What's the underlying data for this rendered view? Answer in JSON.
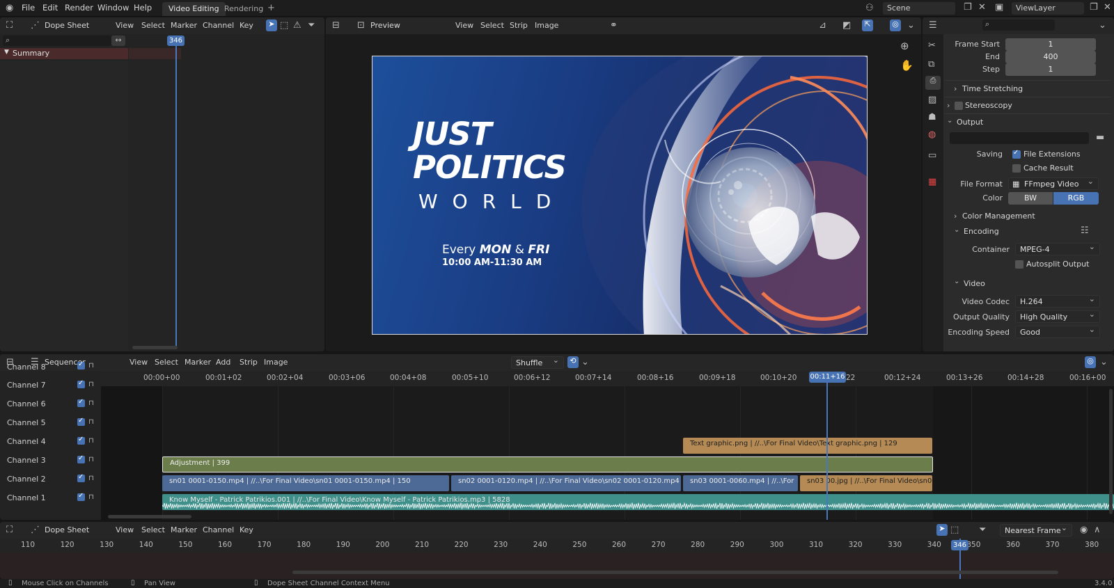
{
  "topbar": {
    "menus": [
      "File",
      "Edit",
      "Render",
      "Window",
      "Help"
    ],
    "tabs": [
      "Video Editing",
      "Rendering"
    ],
    "add_tab": "+",
    "scene": "Scene",
    "view_layer": "ViewLayer"
  },
  "dopesheet_top": {
    "editor": "Dope Sheet",
    "menus": [
      "View",
      "Select",
      "Marker",
      "Channel",
      "Key"
    ],
    "current_frame": "346",
    "summary": "Summary"
  },
  "preview": {
    "mode": "Preview",
    "menus": [
      "View",
      "Select",
      "Strip",
      "Image"
    ],
    "frame_title_line1": "JUST",
    "frame_title_line2": "POLITICS",
    "frame_title_line3": "WORLD",
    "frame_line_every": "Every",
    "frame_line_days_mon": "MON",
    "frame_line_amp": "&",
    "frame_line_days_fri": "FRI",
    "frame_line_time": "10:00 AM-11:30 AM"
  },
  "properties": {
    "frame_start_label": "Frame Start",
    "frame_start": "1",
    "end_label": "End",
    "end": "400",
    "step_label": "Step",
    "step": "1",
    "time_stretching": "Time Stretching",
    "stereoscopy": "Stereoscopy",
    "output": "Output",
    "saving_label": "Saving",
    "file_extensions": "File Extensions",
    "cache_result": "Cache Result",
    "file_format_label": "File Format",
    "file_format": "FFmpeg Video",
    "color_label": "Color",
    "color_bw": "BW",
    "color_rgb": "RGB",
    "color_management": "Color Management",
    "encoding": "Encoding",
    "container_label": "Container",
    "container": "MPEG-4",
    "autosplit": "Autosplit Output",
    "video": "Video",
    "video_codec_label": "Video Codec",
    "video_codec": "H.264",
    "output_quality_label": "Output Quality",
    "output_quality": "High Quality",
    "encoding_speed_label": "Encoding Speed",
    "encoding_speed": "Good"
  },
  "sequencer": {
    "editor": "Sequencer",
    "menus": [
      "View",
      "Select",
      "Marker",
      "Add",
      "Strip",
      "Image"
    ],
    "shuffle": "Shuffle",
    "channels": [
      "Channel 8",
      "Channel 7",
      "Channel 6",
      "Channel 5",
      "Channel 4",
      "Channel 3",
      "Channel 2",
      "Channel 1"
    ],
    "timecodes": [
      "00:00+00",
      "00:01+02",
      "00:02+04",
      "00:03+06",
      "00:04+08",
      "00:05+10",
      "00:06+12",
      "00:07+14",
      "00:08+16",
      "00:09+18",
      "00:10+20",
      "22",
      "00:12+24",
      "00:13+26",
      "00:14+28",
      "00:16+00"
    ],
    "current_timecode": "00:11+16",
    "strips": {
      "text_graphic": "Text graphic.png | //..\\For Final Video\\Text graphic.png | 129",
      "adjustment": "Adjustment | 399",
      "sn01": "sn01 0001-0150.mp4 | //..\\For Final Video\\sn01 0001-0150.mp4 | 150",
      "sn02": "sn02 0001-0120.mp4 | //..\\For Final Video\\sn02 0001-0120.mp4 | 1",
      "sn03": "sn03 0001-0060.mp4 | //..\\For",
      "sn03b": "sn03 00.jpg | //..\\For Final Video\\sn0",
      "audio": "Know Myself - Patrick Patrikios.001 | //..\\For Final Video\\Know Myself - Patrick Patrikios.mp3 | 5828"
    }
  },
  "dopesheet_bottom": {
    "editor": "Dope Sheet",
    "menus": [
      "View",
      "Select",
      "Marker",
      "Channel",
      "Key"
    ],
    "snap": "Nearest Frame",
    "frames": [
      "110",
      "120",
      "130",
      "140",
      "150",
      "160",
      "170",
      "180",
      "190",
      "200",
      "210",
      "220",
      "230",
      "240",
      "250",
      "260",
      "270",
      "280",
      "290",
      "300",
      "310",
      "320",
      "330",
      "340",
      "350",
      "360",
      "370",
      "380"
    ],
    "current_frame": "346"
  },
  "statusbar": {
    "hint1": "Mouse Click on Channels",
    "hint2": "Pan View",
    "hint3": "Dope Sheet Channel Context Menu",
    "version": "3.4.0"
  },
  "colors": {
    "accent": "#4772b3",
    "text_strip": "#b58a54",
    "adjustment_strip": "#6b7d4b",
    "movie_strip": "#4d6a96",
    "audio_strip": "#3f8f8a"
  }
}
